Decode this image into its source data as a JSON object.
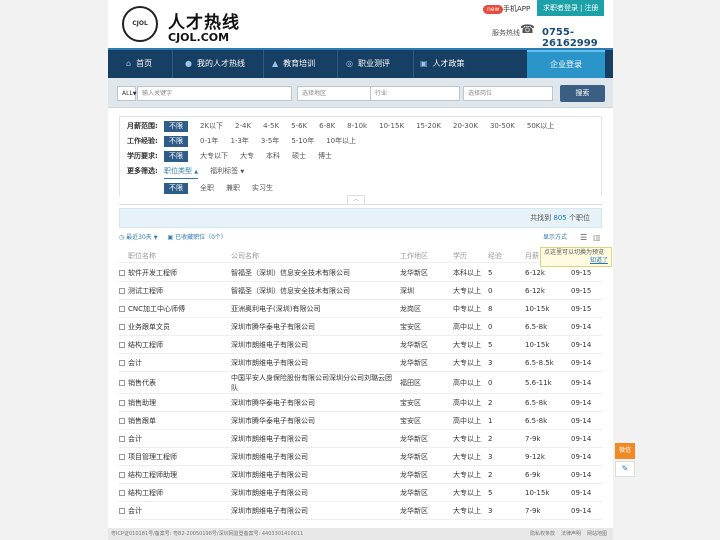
{
  "header": {
    "brand_cn": "人才热线",
    "brand_en": "CJOL.COM",
    "logo_text": "CJOL 1997",
    "new_badge": "new",
    "app_link": "手机APP",
    "login_link": "求职者登录",
    "register_link": "注册",
    "hotline_label": "服务热线",
    "hotline": "0755-26162999"
  },
  "nav": {
    "items": [
      {
        "label": "首页",
        "icon": "home-icon"
      },
      {
        "label": "我的人才热线",
        "icon": "user-icon"
      },
      {
        "label": "教育培训",
        "icon": "graduation-cap-icon"
      },
      {
        "label": "职业测评",
        "icon": "target-icon"
      },
      {
        "label": "人才政策",
        "icon": "book-icon"
      }
    ],
    "enterprise_login": "企业登录"
  },
  "search": {
    "type_value": "ALL",
    "keyword_placeholder": "输入关键字",
    "area_placeholder": "选择地区",
    "industry_placeholder": "行业",
    "position_placeholder": "选择岗位",
    "button": "搜索"
  },
  "filters": {
    "salary": {
      "label": "月薪范围:",
      "options": [
        "不限",
        "2K以下",
        "2-4K",
        "4-5K",
        "5-6K",
        "6-8K",
        "8-10k",
        "10-15K",
        "15-20K",
        "20-30K",
        "30-50K",
        "50K以上"
      ]
    },
    "experience": {
      "label": "工作经验:",
      "options": [
        "不限",
        "0-1年",
        "1-3年",
        "3-5年",
        "5-10年",
        "10年以上"
      ]
    },
    "education": {
      "label": "学历要求:",
      "options": [
        "不限",
        "大专以下",
        "大专",
        "本科",
        "硕士",
        "博士"
      ]
    },
    "more": {
      "label": "更多筛选:",
      "position_type": "职位类型",
      "welfare": "福利标签"
    },
    "jobtype": {
      "options": [
        "不限",
        "全职",
        "兼职",
        "实习生"
      ]
    }
  },
  "result": {
    "prefix": "共找到",
    "count": "805",
    "suffix": "个职位"
  },
  "toolbar": {
    "recent": "最近30天",
    "saved": "已收藏职位（0个）",
    "display_mode": "显示方式"
  },
  "tooltip": {
    "text": "点这里可以切换为预览",
    "link": "知道了"
  },
  "table": {
    "headers": [
      "职位名称",
      "公司名称",
      "工作地区",
      "学历",
      "经验",
      "月薪",
      "日期"
    ],
    "rows": [
      [
        "软件开发工程师",
        "智福圣（深圳）信息安全技术有限公司",
        "龙华新区",
        "本科以上",
        "5",
        "6-12k",
        "09-15"
      ],
      [
        "测试工程师",
        "智福圣（深圳）信息安全技术有限公司",
        "深圳",
        "大专以上",
        "0",
        "6-12k",
        "09-15"
      ],
      [
        "CNC加工中心师傅",
        "亚洲奥利电子(深圳)有限公司",
        "龙岗区",
        "中专以上",
        "8",
        "10-15k",
        "09-15"
      ],
      [
        "业务跟单文员",
        "深圳市腾华泰电子有限公司",
        "宝安区",
        "高中以上",
        "0",
        "6.5-8k",
        "09-14"
      ],
      [
        "结构工程师",
        "深圳市朗维电子有限公司",
        "龙华新区",
        "大专以上",
        "5",
        "10-15k",
        "09-14"
      ],
      [
        "会计",
        "深圳市朗维电子有限公司",
        "龙华新区",
        "大专以上",
        "3",
        "6.5-8.5k",
        "09-14"
      ],
      [
        "销售代表",
        "中国平安人身保险股份有限公司深圳分公司刘璐云团队",
        "福田区",
        "高中以上",
        "0",
        "5.6-11k",
        "09-14"
      ],
      [
        "销售助理",
        "深圳市腾华泰电子有限公司",
        "宝安区",
        "高中以上",
        "2",
        "6.5-8k",
        "09-14"
      ],
      [
        "销售跟单",
        "深圳市腾华泰电子有限公司",
        "宝安区",
        "高中以上",
        "1",
        "6.5-8k",
        "09-14"
      ],
      [
        "会计",
        "深圳市朗维电子有限公司",
        "龙华新区",
        "大专以上",
        "2",
        "7-9k",
        "09-14"
      ],
      [
        "项目管理工程师",
        "深圳市朗维电子有限公司",
        "龙华新区",
        "大专以上",
        "3",
        "9-12k",
        "09-14"
      ],
      [
        "结构工程师助理",
        "深圳市朗维电子有限公司",
        "龙华新区",
        "大专以上",
        "2",
        "6-9k",
        "09-14"
      ],
      [
        "结构工程师",
        "深圳市朗维电子有限公司",
        "龙华新区",
        "大专以上",
        "5",
        "10-15k",
        "09-14"
      ],
      [
        "会计",
        "深圳市朗维电子有限公司",
        "龙华新区",
        "大专以上",
        "3",
        "7-9k",
        "09-14"
      ]
    ]
  },
  "footer": {
    "icp": "粤ICP证010181号/备案号: 粤B2-20050198号/深圳网监登备案号: 4403301410011",
    "links": [
      "隐私权条款",
      "法律声明",
      "网站地图"
    ]
  },
  "side": {
    "wechat": "微信",
    "edit_icon": "edit-icon"
  }
}
